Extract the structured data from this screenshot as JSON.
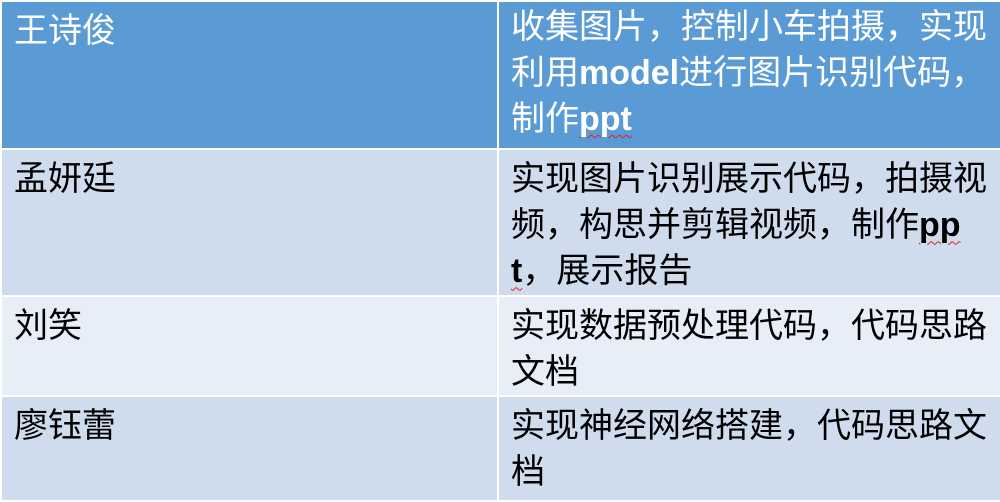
{
  "table": {
    "rows": [
      {
        "name": "王诗俊",
        "task_parts": [
          "收集图片，控制小车拍摄，实现利用",
          "model",
          "进行图片识别代码，制作",
          "ppt",
          ""
        ]
      },
      {
        "name": "孟妍廷",
        "task_parts": [
          "实现图片识别展示代码，拍摄视频，构思并剪辑视频，制作",
          "ppt",
          "，展示报告"
        ]
      },
      {
        "name": "刘笑",
        "task_parts": [
          "实现数据预处理代码，代码思路文档"
        ]
      },
      {
        "name": "廖钰蕾",
        "task_parts": [
          "实现神经网络搭建，代码思路文档"
        ]
      }
    ]
  },
  "colors": {
    "header_bg": "#5b9bd5",
    "band_dark": "#cfdcee",
    "band_light": "#e8eef7",
    "spellcheck": "#e02020"
  }
}
